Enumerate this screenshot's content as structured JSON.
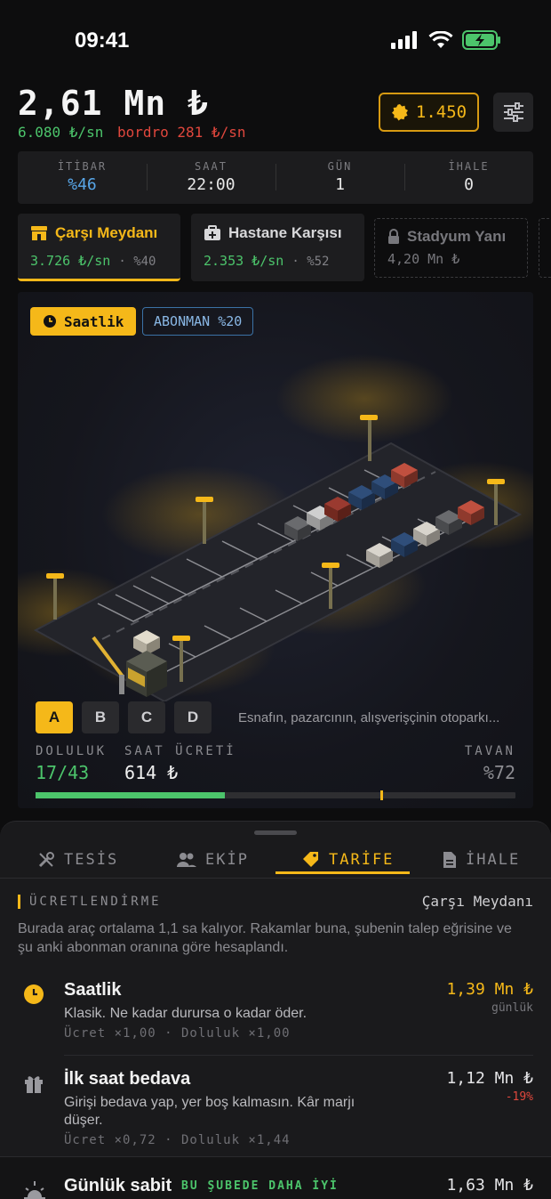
{
  "status": {
    "time": "09:41"
  },
  "header": {
    "balance": "2,61 Mn ₺",
    "income_rate": "6.080 ₺/sn",
    "payroll_label": "bordro 281 ₺/sn",
    "coins": "1.450"
  },
  "stats": [
    {
      "label": "İTİBAR",
      "value": "%46"
    },
    {
      "label": "SAAT",
      "value": "22:00"
    },
    {
      "label": "GÜN",
      "value": "1"
    },
    {
      "label": "İHALE",
      "value": "0"
    }
  ],
  "locations": [
    {
      "name": "Çarşı Meydanı",
      "rate": "3.726 ₺/sn",
      "share": "· %40"
    },
    {
      "name": "Hastane Karşısı",
      "rate": "2.353 ₺/sn",
      "share": "· %52"
    },
    {
      "name": "Stadyum Yanı",
      "price": "4,20 Mn ₺"
    }
  ],
  "scene": {
    "tariff_pill": "Saatlik",
    "subscription_pill": "ABONMAN %20",
    "zones": [
      "A",
      "B",
      "C",
      "D"
    ],
    "zone_description": "Esnafın, pazarcının, alışverişçinin otoparkı...",
    "metrics": {
      "occupancy_label": "DOLULUK",
      "occupancy_value": "17/43",
      "hourly_fee_label": "SAAT ÜCRETİ",
      "hourly_fee_value": "614 ₺",
      "cap_label": "TAVAN",
      "cap_value": "%72"
    },
    "occupancy_fraction": 0.395,
    "cap_fraction": 0.72
  },
  "sheet": {
    "tabs": [
      "TESİS",
      "EKİP",
      "TARİFE",
      "İHALE"
    ],
    "section_title": "ÜCRETLENDİRME",
    "section_location": "Çarşı Meydanı",
    "section_description": "Burada araç ortalama 1,1 sa kalıyor. Rakamlar buna, şubenin talep eğrisine ve şu anki abonman oranına göre hesaplandı.",
    "options": [
      {
        "title": "Saatlik",
        "description": "Klasik. Ne kadar durursa o kadar öder.",
        "meta": "Ücret ×1,00 · Doluluk ×1,00",
        "price": "1,39 Mn ₺",
        "note": "günlük",
        "icon": "clock-icon"
      },
      {
        "title": "İlk saat bedava",
        "description": "Girişi bedava yap, yer boş kalmasın. Kâr marjı düşer.",
        "meta": "Ücret ×0,72 · Doluluk ×1,44",
        "price": "1,12 Mn ₺",
        "note": "-19%",
        "icon": "gift-icon"
      },
      {
        "title": "Günlük sabit",
        "badge": "BU ŞUBEDE DAHA İYİ",
        "price": "1,63 Mn ₺",
        "icon": "sunrise-icon"
      }
    ]
  },
  "colors": {
    "accent": "#f5b819",
    "positive": "#4cc46b",
    "negative": "#e0473d",
    "info": "#58a6e8"
  }
}
